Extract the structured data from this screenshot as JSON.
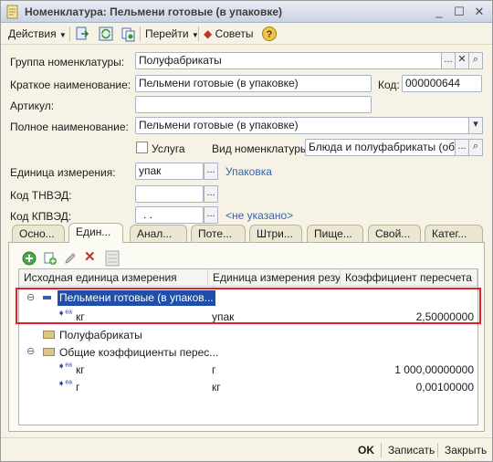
{
  "window": {
    "title": "Номенклатура: Пельмени готовые (в упаковке)"
  },
  "toolbar": {
    "actions_label": "Действия",
    "goto_label": "Перейти",
    "tips_label": "Советы"
  },
  "form": {
    "group_label": "Группа номенклатуры:",
    "group_value": "Полуфабрикаты",
    "short_name_label": "Краткое наименование:",
    "short_name_value": "Пельмени готовые (в упаковке)",
    "code_label": "Код:",
    "code_value": "000000644",
    "article_label": "Артикул:",
    "article_value": "",
    "full_name_label": "Полное наименование:",
    "full_name_value": "Пельмени готовые (в упаковке)",
    "service_label": "Услуга",
    "kind_label": "Вид номенклатуры:",
    "kind_value": "Блюда и полуфабрикаты (общее",
    "unit_label": "Единица измерения:",
    "unit_value": "упак",
    "unit_link": "Упаковка",
    "tnved_label": "Код ТНВЭД:",
    "tnved_value": "",
    "kpved_label": "Код КПВЭД:",
    "kpved_value": ". .",
    "kpved_link": "<не указано>"
  },
  "tabs": [
    {
      "label": "Осно..."
    },
    {
      "label": "Един..."
    },
    {
      "label": "Анал..."
    },
    {
      "label": "Поте..."
    },
    {
      "label": "Штри..."
    },
    {
      "label": "Пище..."
    },
    {
      "label": "Свой..."
    },
    {
      "label": "Катег..."
    }
  ],
  "table": {
    "columns": [
      "Исходная единица измерения",
      "Единица измерения резу...",
      "Коэффициент пересчета"
    ],
    "rows": [
      {
        "source": "Пельмени готовые (в упаков...",
        "target": "",
        "coef": ""
      },
      {
        "source": "кг",
        "target": "упак",
        "coef": "2,50000000"
      },
      {
        "source": "Полуфабрикаты",
        "target": "",
        "coef": ""
      },
      {
        "source": "Общие коэффициенты перес...",
        "target": "",
        "coef": ""
      },
      {
        "source": "кг",
        "target": "г",
        "coef": "1 000,00000000"
      },
      {
        "source": "г",
        "target": "кг",
        "coef": "0,00100000"
      }
    ]
  },
  "footer": {
    "ok_label": "OK",
    "save_label": "Записать",
    "close_label": "Закрыть"
  },
  "colors": {
    "highlight_border": "#e0202a",
    "selection_bg": "#1f4fa8",
    "link": "#3a63b0"
  }
}
